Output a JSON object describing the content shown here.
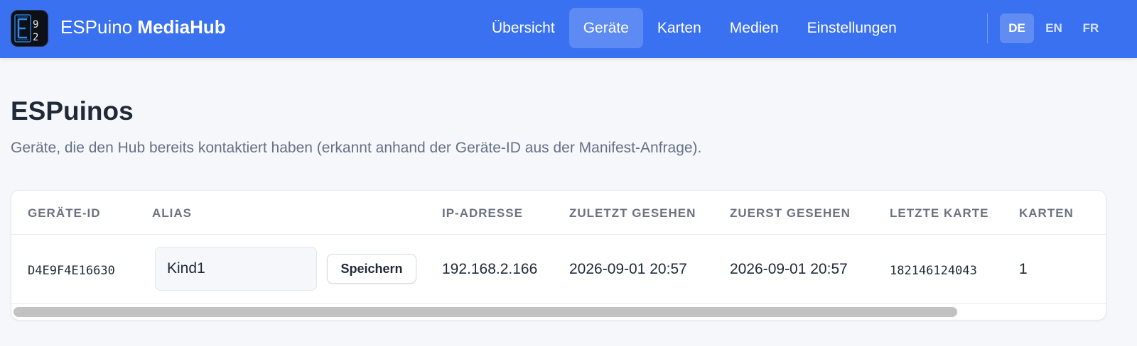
{
  "header": {
    "brand_light": "ESPuino",
    "brand_bold": "MediaHub",
    "nav": [
      {
        "label": "Übersicht",
        "active": false
      },
      {
        "label": "Geräte",
        "active": true
      },
      {
        "label": "Karten",
        "active": false
      },
      {
        "label": "Medien",
        "active": false
      },
      {
        "label": "Einstellungen",
        "active": false
      }
    ],
    "languages": [
      {
        "label": "DE",
        "active": true
      },
      {
        "label": "EN",
        "active": false
      },
      {
        "label": "FR",
        "active": false
      }
    ],
    "accent_color": "#3a71f1"
  },
  "page": {
    "title": "ESPuinos",
    "subtitle": "Geräte, die den Hub bereits kontaktiert haben (erkannt anhand der Geräte-ID aus der Manifest-Anfrage)."
  },
  "table": {
    "columns": [
      "GERÄTE-ID",
      "ALIAS",
      "IP-ADRESSE",
      "ZULETZT GESEHEN",
      "ZUERST GESEHEN",
      "LETZTE KARTE",
      "KARTEN"
    ],
    "rows": [
      {
        "device_id": "D4E9F4E16630",
        "alias": "Kind1",
        "save_label": "Speichern",
        "ip": "192.168.2.166",
        "last_seen": "2026-09-01 20:57",
        "first_seen": "2026-09-01 20:57",
        "last_card": "182146124043",
        "cards": "1"
      }
    ]
  }
}
